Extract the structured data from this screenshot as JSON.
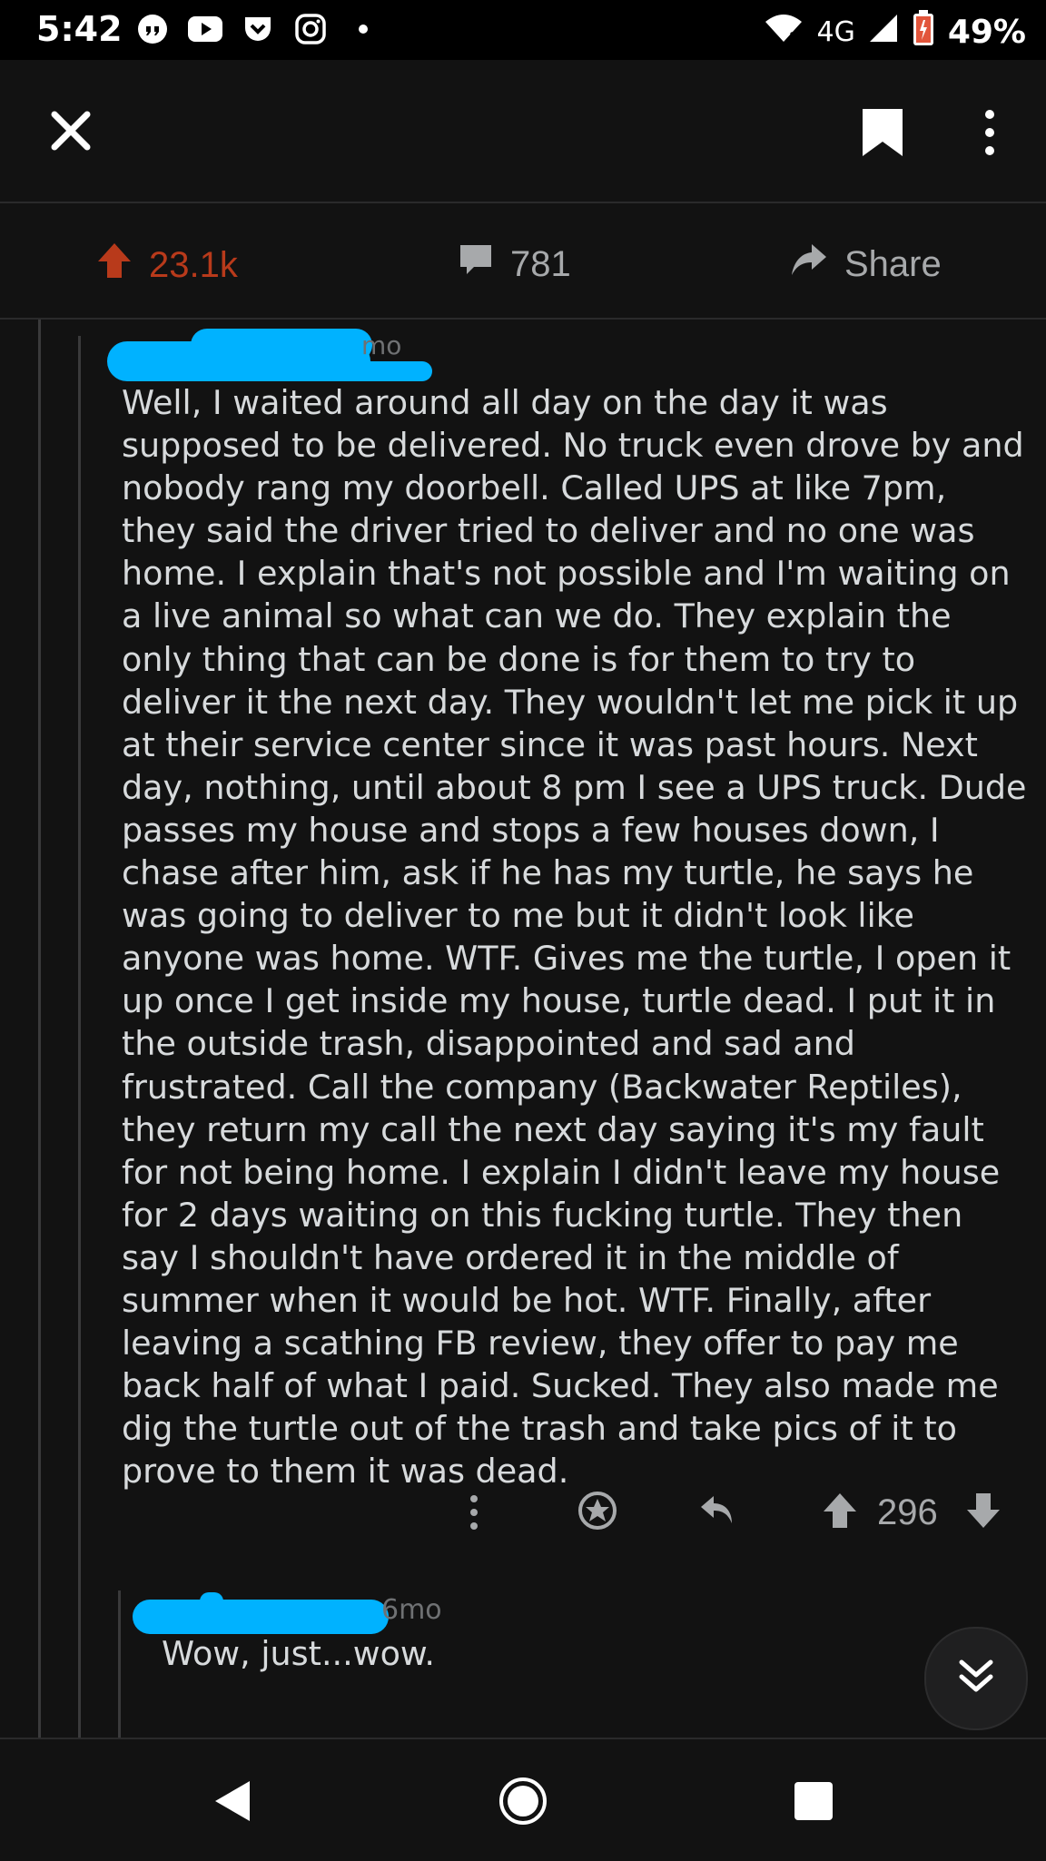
{
  "status_bar": {
    "time": "5:42",
    "network": "4G",
    "battery": "49%",
    "icons": [
      "quote-icon",
      "youtube-icon",
      "pocket-icon",
      "instagram-icon",
      "dot-icon",
      "wifi-icon",
      "signal-icon",
      "battery-icon"
    ]
  },
  "toolbar": {
    "icons": [
      "close-icon",
      "bookmark-icon",
      "more-vertical-icon"
    ]
  },
  "post_actions": {
    "upvotes": "23.1k",
    "comments": "781",
    "share_label": "Share",
    "upvote_color": "#b83a1b"
  },
  "comment": {
    "meta_visible": "mo",
    "paragraph": "Well, I waited around all day on the day it was supposed to be delivered. No truck even drove by and nobody rang my doorbell. Called UPS at like 7pm, they said the driver tried to deliver and no one was home. I explain that's not possible and I'm waiting on a live animal so what can we do. They explain the only thing that can be done is for them to try to deliver it the next day. They wouldn't let me pick it up at their service center since it was past hours. Next day, nothing, until about 8 pm I see a UPS truck. Dude passes my house and stops a few houses down, I chase after him, ask if he has my turtle, he says he was going to deliver to me but it didn't look like anyone was home. WTF. Gives me the turtle, I open it up once I get inside my house, turtle dead. I put it in the outside trash, disappointed and sad and frustrated. Call the company (Backwater Reptiles), they return my call the next day saying it's my fault for not being home. I explain I didn't leave my house for 2 days waiting on this fucking turtle. They then say I shouldn't have ordered it in the middle of summer when it would be hot. WTF. Finally, after leaving a scathing FB review, they offer to pay me back half of what I paid. Sucked. They also made me dig the turtle out of the trash and take pics of it to prove to them it was dead.",
    "score": "296",
    "redaction_color": "#00b2ff"
  },
  "reply": {
    "meta_visible": "6mo",
    "text": "Wow, just...wow."
  }
}
